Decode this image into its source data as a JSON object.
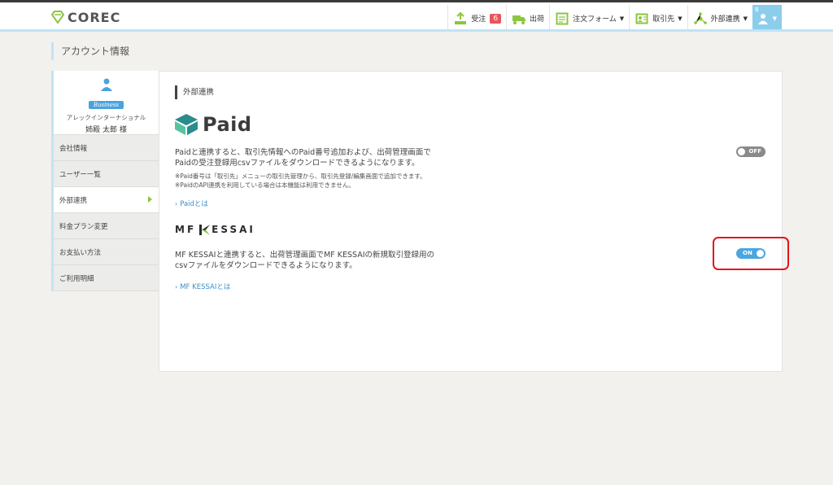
{
  "header": {
    "logo_text": "COREC",
    "nav": {
      "orders_label": "受注",
      "orders_badge": "6",
      "shipping_label": "出荷",
      "order_form_label": "注文フォーム",
      "suppliers_label": "取引先",
      "integrations_label": "外部連携",
      "user_letter": "B"
    }
  },
  "page": {
    "title": "アカウント情報"
  },
  "sidebar": {
    "profile": {
      "plan_badge": "Business",
      "company": "アレックインターナショナル",
      "person": "姉殿 太郎 様"
    },
    "items": [
      {
        "label": "会社情報"
      },
      {
        "label": "ユーザー一覧"
      },
      {
        "label": "外部連携"
      },
      {
        "label": "料金プラン変更"
      },
      {
        "label": "お支払い方法"
      },
      {
        "label": "ご利用明細"
      }
    ]
  },
  "main": {
    "section_title": "外部連携",
    "paid": {
      "logo_text": "Paid",
      "desc_line1": "Paidと連携すると、取引先情報へのPaid番号追加および、出荷管理画面で",
      "desc_line2": "Paidの受注登録用csvファイルをダウンロードできるようになります。",
      "note_line1": "※Paid番号は「取引先」メニューの取引先管理から、取引先登録/編集画面で追加できます。",
      "note_line2": "※PaidのAPI連携を利用している場合は本機能は利用できません。",
      "link_text": "Paidとは",
      "toggle_text": "OFF",
      "toggle_state": "off"
    },
    "mfkessai": {
      "logo_text_left": "MF",
      "logo_text_right": "ESSAI",
      "desc_line1": "MF KESSAIと連携すると、出荷管理画面でMF KESSAIの新規取引登録用の",
      "desc_line2": "csvファイルをダウンロードできるようになります。",
      "link_text": "MF KESSAIとは",
      "toggle_text": "ON",
      "toggle_state": "on"
    }
  },
  "colors": {
    "accent_blue": "#4aa6e0",
    "header_line": "#bfe3f6",
    "badge_red": "#e9555a",
    "highlight_red": "#e5141b",
    "nav_green": "#8cc63f"
  }
}
